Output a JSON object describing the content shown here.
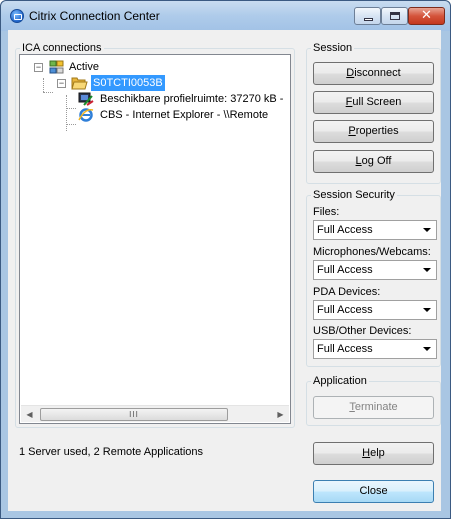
{
  "window": {
    "title": "Citrix Connection Center"
  },
  "connections": {
    "group_label": "ICA connections",
    "root_label": "Active",
    "server_label": "S0TCTI0053B",
    "apps": [
      "Beschikbare profielruimte:  37270 kB -",
      "CBS - Internet Explorer - \\\\Remote"
    ],
    "scroll_thumb_grip": "III"
  },
  "session": {
    "group_label": "Session",
    "disconnect": {
      "before": "",
      "key": "D",
      "after": "isconnect"
    },
    "full_screen": {
      "before": "",
      "key": "F",
      "after": "ull Screen"
    },
    "properties": {
      "before": "",
      "key": "P",
      "after": "roperties"
    },
    "log_off": {
      "before": "",
      "key": "L",
      "after": "og Off"
    }
  },
  "security": {
    "group_label": "Session Security",
    "files_label": "Files:",
    "files_value": "Full Access",
    "mic_label": "Microphones/Webcams:",
    "mic_value": "Full Access",
    "pda_label": "PDA Devices:",
    "pda_value": "Full Access",
    "usb_label": "USB/Other Devices:",
    "usb_value": "Full Access"
  },
  "application": {
    "group_label": "Application",
    "terminate": {
      "before": "",
      "key": "T",
      "after": "erminate"
    }
  },
  "status": {
    "text": "1 Server used, 2 Remote Applications"
  },
  "footer": {
    "help": {
      "before": "",
      "key": "H",
      "after": "elp"
    },
    "close_label": "Close"
  },
  "colors": {
    "selection": "#3399ff",
    "title_gradient": "#aecbea",
    "close_button": "#c4371e"
  }
}
